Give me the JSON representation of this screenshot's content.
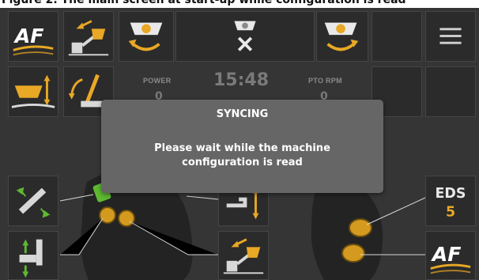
{
  "header_text": "Figure 2.   The main screen at start-up while configuration is read",
  "top_bar": {
    "af_label": "AF",
    "menu": "hamburger-menu"
  },
  "status": {
    "power_label": "POWER",
    "power_value": "0",
    "clock": "15:48",
    "pto_label": "PTO RPM",
    "pto_value": "0"
  },
  "right_column": {
    "eds_label": "EDS",
    "eds_value": "5",
    "af_label": "AF"
  },
  "modal": {
    "title": "SYNCING",
    "message_line1": "Please wait while the machine",
    "message_line2": "configuration is read"
  },
  "colors": {
    "accent": "#e9a825",
    "tile_bg": "#2b2b2b",
    "screen_bg": "#353535",
    "modal_bg": "#666666",
    "green": "#5fb832"
  }
}
